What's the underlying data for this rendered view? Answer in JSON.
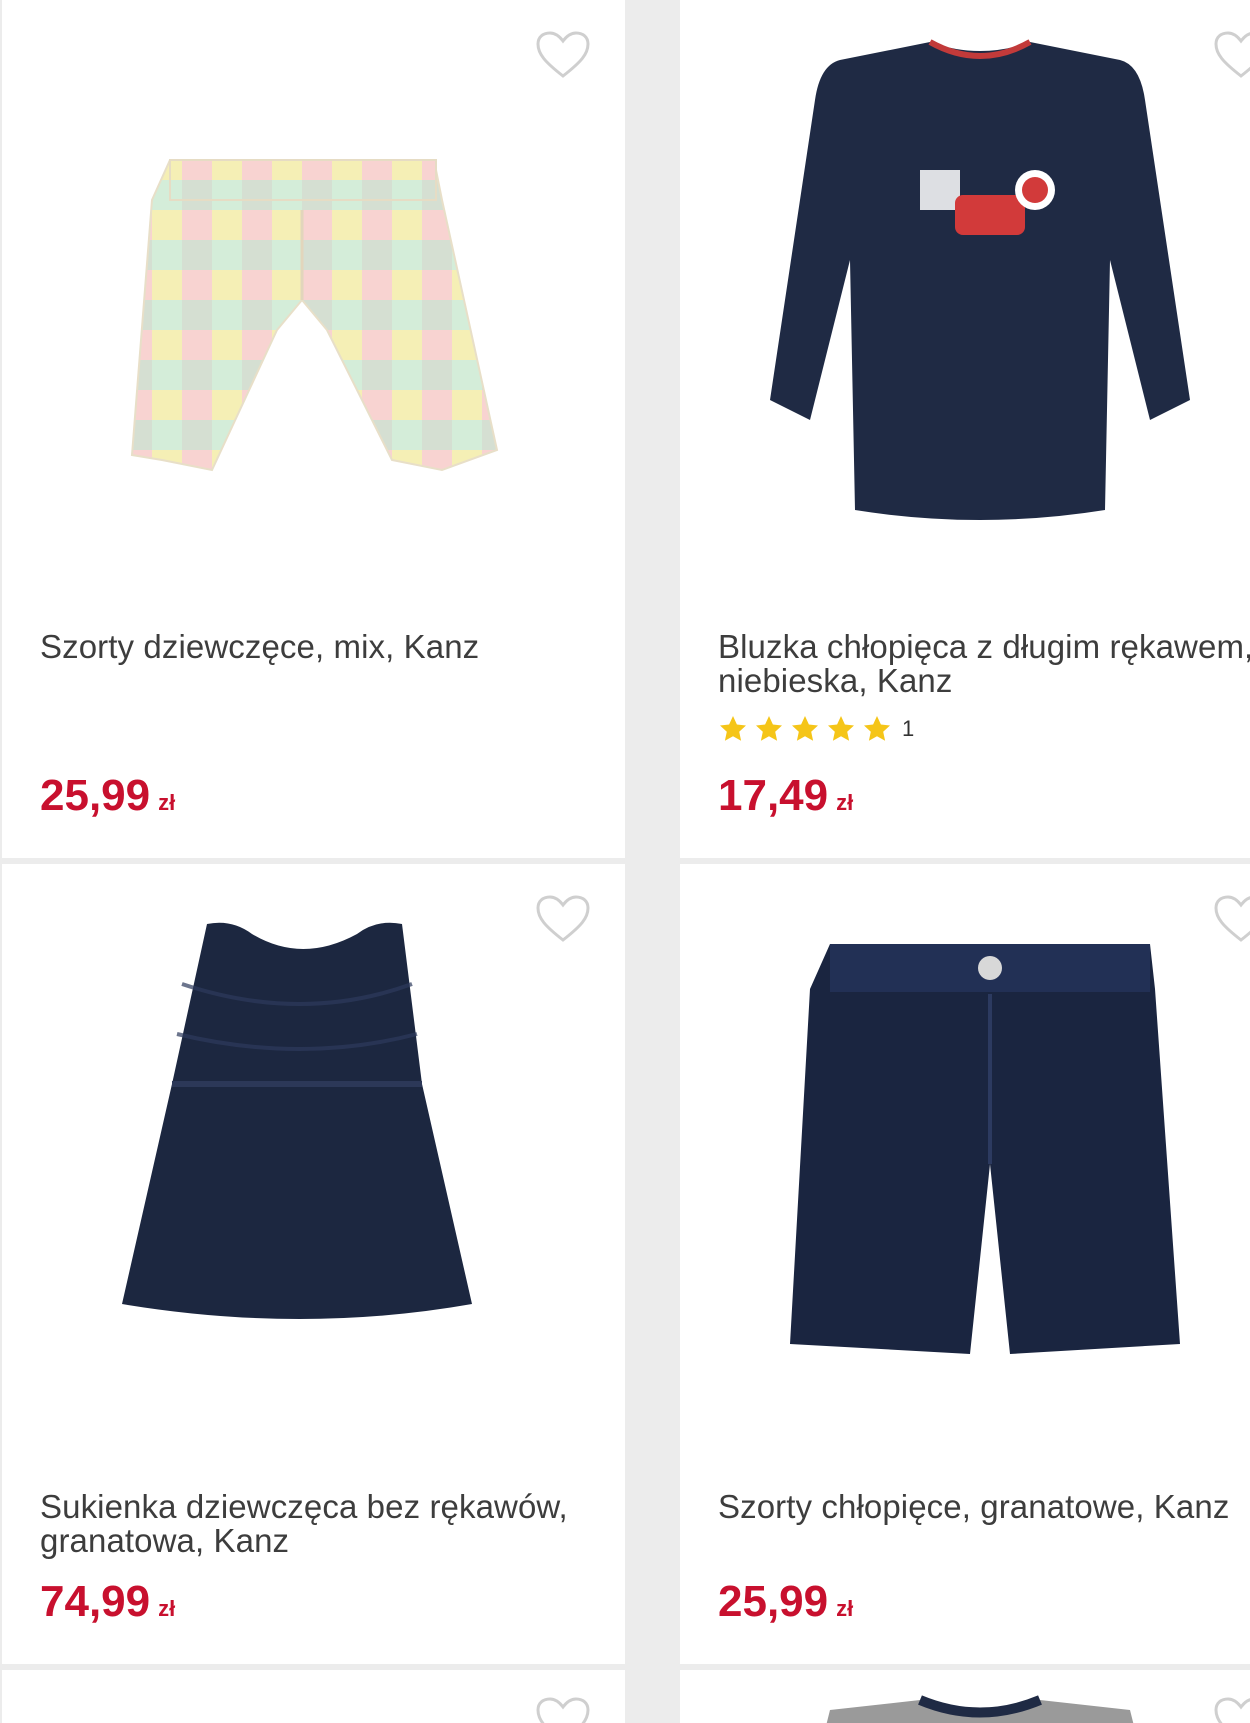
{
  "products": [
    {
      "name": "Szorty dziewczęce, mix, Kanz",
      "price": "25,99",
      "currency": "zł"
    },
    {
      "name": "Bluzka chłopięca z długim rękawem, niebieska, Kanz",
      "price": "17,49",
      "currency": "zł",
      "rating_stars": 5,
      "rating_count": "1"
    },
    {
      "name": "Sukienka dziewczęca bez rękawów, granatowa, Kanz",
      "price": "74,99",
      "currency": "zł"
    },
    {
      "name": "Szorty chłopięce, granatowe, Kanz",
      "price": "25,99",
      "currency": "zł"
    }
  ],
  "colors": {
    "price": "#c8102e",
    "star": "#f5c518",
    "heart": "#cfcfcf",
    "background": "#ececec"
  },
  "icons": [
    "heart-outline-icon",
    "star-icon"
  ]
}
